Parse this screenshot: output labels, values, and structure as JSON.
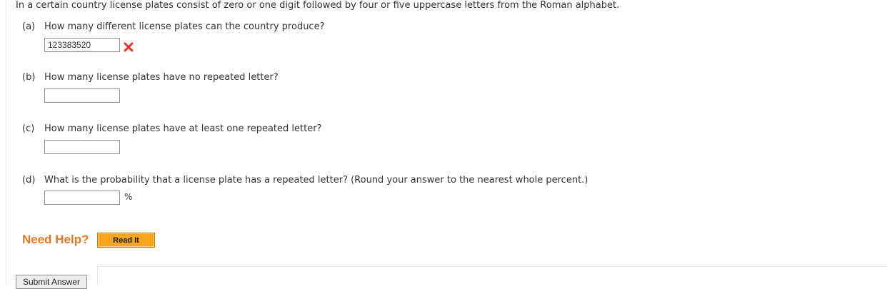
{
  "question": {
    "intro": "In a certain country license plates consist of zero or one digit followed by four or five uppercase letters from the Roman alphabet.",
    "parts": [
      {
        "letter": "(a)",
        "text": "How many different license plates can the country produce?",
        "answer_value": "123383520",
        "answer_status": "incorrect"
      },
      {
        "letter": "(b)",
        "text": "How many license plates have no repeated letter?",
        "answer_value": ""
      },
      {
        "letter": "(c)",
        "text": "How many license plates have at least one repeated letter?",
        "answer_value": ""
      },
      {
        "letter": "(d)",
        "text": "What is the probability that a license plate has a repeated letter? (Round your answer to the nearest whole percent.)",
        "answer_value": "",
        "unit": "%"
      }
    ]
  },
  "help": {
    "label": "Need Help?",
    "read_it_label": "Read It"
  },
  "submit": {
    "label": "Submit Answer"
  },
  "icons": {
    "incorrect": "wrong-x-icon"
  },
  "colors": {
    "need_help": "#e87722",
    "read_it_bg": "#f7a51d",
    "incorrect": "#e8302a"
  }
}
